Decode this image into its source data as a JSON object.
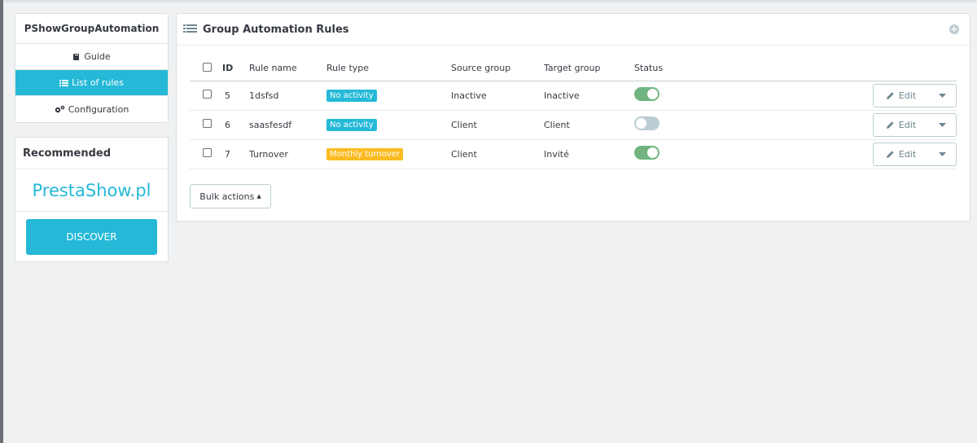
{
  "sidebar": {
    "title": "PShowGroupAutomation",
    "items": [
      {
        "label": "Guide",
        "icon": "book-icon"
      },
      {
        "label": "List of rules",
        "icon": "list-icon"
      },
      {
        "label": "Configuration",
        "icon": "cogs-icon"
      }
    ]
  },
  "recommended": {
    "title": "Recommended",
    "brand": "PrestaShow.pl",
    "button": "DISCOVER"
  },
  "panel": {
    "title": "Group Automation Rules",
    "columns": {
      "id": "ID",
      "name": "Rule name",
      "type": "Rule type",
      "source": "Source group",
      "target": "Target group",
      "status": "Status"
    },
    "rows": [
      {
        "id": "5",
        "name": "1dsfsd",
        "type": "No activity",
        "type_color": "#25b9d7",
        "source": "Inactive",
        "target": "Inactive",
        "status": "on",
        "edit": "Edit"
      },
      {
        "id": "6",
        "name": "saasfesdf",
        "type": "No activity",
        "type_color": "#25b9d7",
        "source": "Client",
        "target": "Client",
        "status": "off",
        "edit": "Edit"
      },
      {
        "id": "7",
        "name": "Turnover",
        "type": "Monthly turnover",
        "type_color": "#fbbb22",
        "source": "Client",
        "target": "Invité",
        "status": "on",
        "edit": "Edit"
      }
    ],
    "bulk_actions": "Bulk actions"
  },
  "colors": {
    "accent": "#25b9d7",
    "toggle_on": "#70b580",
    "toggle_off": "#bbcdd2",
    "badge_warning": "#fbbb22"
  }
}
